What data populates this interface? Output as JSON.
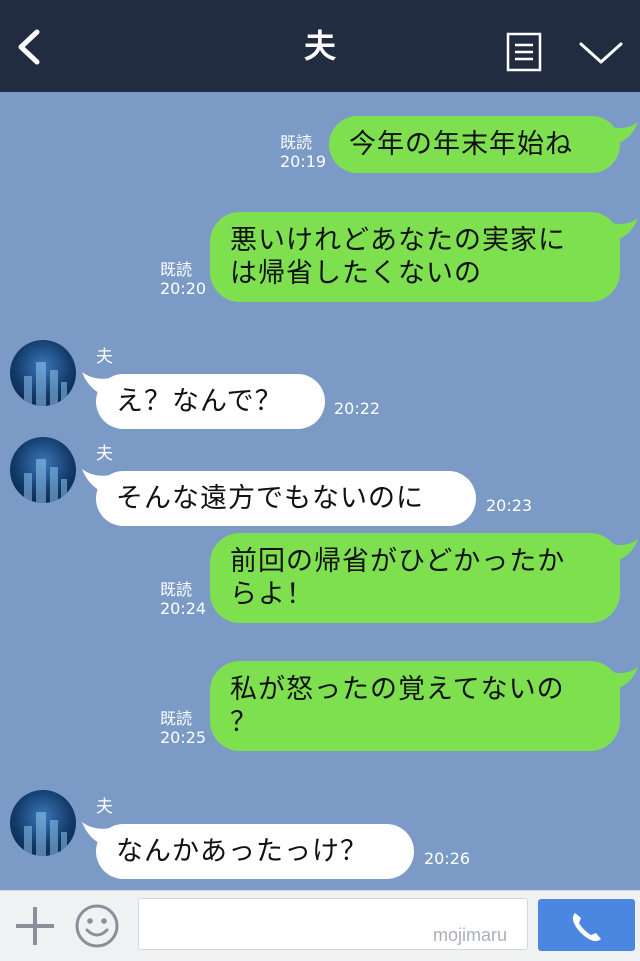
{
  "header": {
    "title": "夫"
  },
  "chat": {
    "read_label": "既読",
    "sender_name": "夫",
    "messages": [
      {
        "from": "me",
        "text": "今年の年末年始ね",
        "time": "20:19"
      },
      {
        "from": "me",
        "text": "悪いけれどあなたの実家に\nは帰省したくないの",
        "time": "20:20"
      },
      {
        "from": "them",
        "text": "え？なんで？",
        "time": "20:22"
      },
      {
        "from": "them",
        "text": "そんな遠方でもないのに",
        "time": "20:23"
      },
      {
        "from": "me",
        "text": "前回の帰省がひどかったか\nらよ！",
        "time": "20:24"
      },
      {
        "from": "me",
        "text": "私が怒ったの覚えてないの\n？",
        "time": "20:25"
      },
      {
        "from": "them",
        "text": "なんかあったっけ？",
        "time": "20:26"
      }
    ]
  },
  "input": {
    "placeholder": "",
    "watermark": "mojimaru"
  },
  "icons": {
    "back": "chevron-left-icon",
    "menu": "document-menu-icon",
    "collapse": "chevron-down-icon",
    "plus": "plus-icon",
    "emoji": "smiley-icon",
    "call": "phone-icon"
  },
  "colors": {
    "header": "#222c40",
    "chat_bg": "#7b9bc6",
    "my_bubble": "#7ee04f",
    "their_bubble": "#ffffff",
    "call_button": "#4b86e0"
  }
}
